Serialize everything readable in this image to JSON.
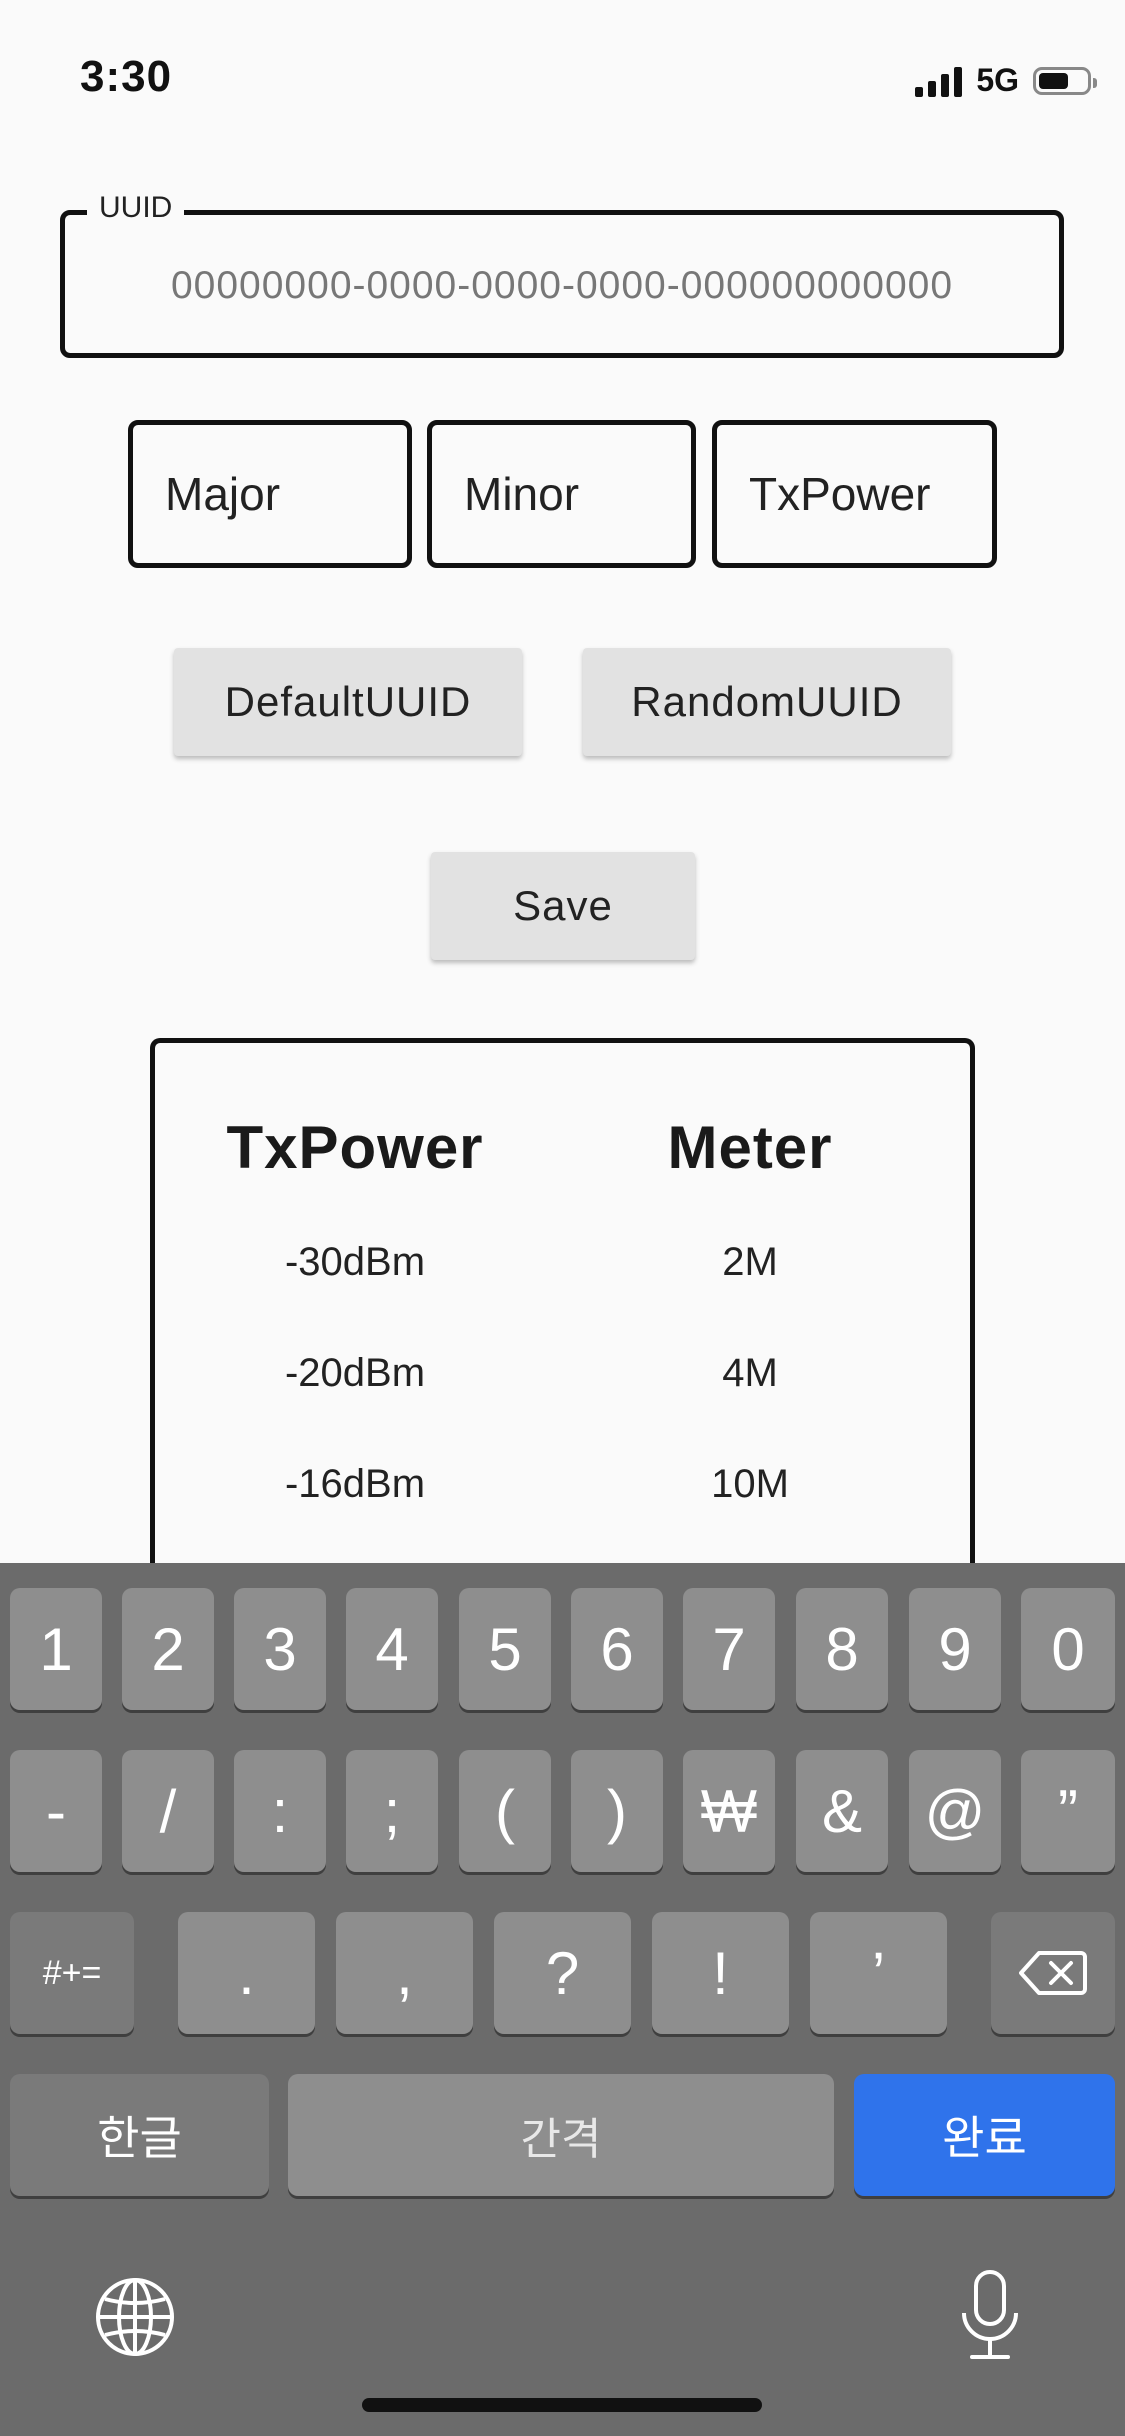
{
  "status_bar": {
    "time": "3:30",
    "network": "5G"
  },
  "form": {
    "uuid_label": "UUID",
    "uuid_placeholder": "00000000-0000-0000-0000-000000000000",
    "major_placeholder": "Major",
    "minor_placeholder": "Minor",
    "txpower_placeholder": "TxPower"
  },
  "buttons": {
    "default_uuid": "DefaultUUID",
    "random_uuid": "RandomUUID",
    "save": "Save"
  },
  "table": {
    "headers": [
      "TxPower",
      "Meter"
    ],
    "rows": [
      [
        "-30dBm",
        "2M"
      ],
      [
        "-20dBm",
        "4M"
      ],
      [
        "-16dBm",
        "10M"
      ]
    ]
  },
  "keyboard": {
    "row1": [
      "1",
      "2",
      "3",
      "4",
      "5",
      "6",
      "7",
      "8",
      "9",
      "0"
    ],
    "row2": [
      "-",
      "/",
      ":",
      ";",
      "(",
      ")",
      "₩",
      "&",
      "@",
      "”"
    ],
    "row3": {
      "mode": "#+=",
      "keys": [
        ".",
        ",",
        "?",
        "!",
        "’"
      ]
    },
    "row4": {
      "lang": "한글",
      "space": "간격",
      "done": "완료"
    },
    "icons": {
      "delete": "backspace-icon",
      "globe": "globe-icon",
      "mic": "microphone-icon"
    },
    "accent_color": "#2f73eb"
  }
}
